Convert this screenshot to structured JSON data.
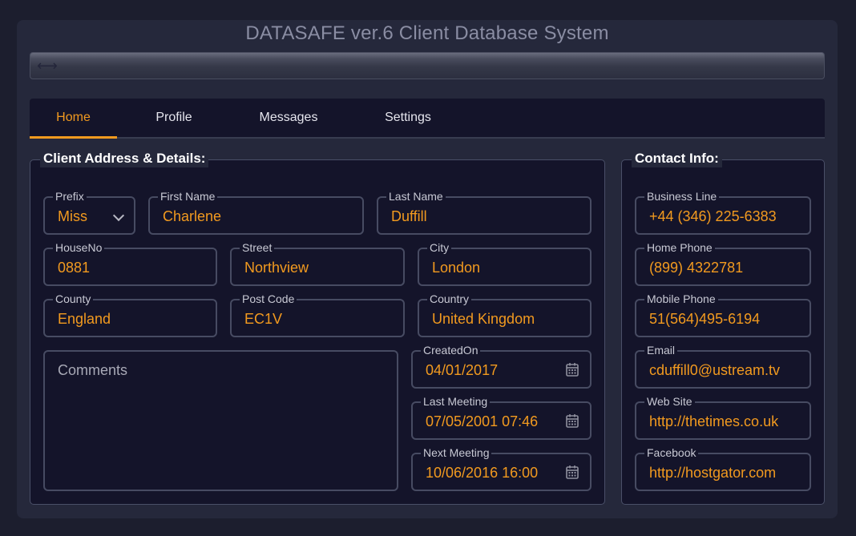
{
  "app": {
    "title": "DATASAFE ver.6 Client Database System"
  },
  "toolbar": {
    "grip_icon": "⟷"
  },
  "tabs": [
    {
      "label": "Home",
      "active": true
    },
    {
      "label": "Profile",
      "active": false
    },
    {
      "label": "Messages",
      "active": false
    },
    {
      "label": "Settings",
      "active": false
    }
  ],
  "client_section": {
    "title": "Client Address & Details:",
    "prefix": {
      "label": "Prefix",
      "value": "Miss"
    },
    "first_name": {
      "label": "First Name",
      "value": "Charlene"
    },
    "last_name": {
      "label": "Last Name",
      "value": "Duffill"
    },
    "house_no": {
      "label": "HouseNo",
      "value": "0881"
    },
    "street": {
      "label": "Street",
      "value": "Northview"
    },
    "city": {
      "label": "City",
      "value": "London"
    },
    "county": {
      "label": "County",
      "value": "England"
    },
    "post_code": {
      "label": "Post Code",
      "value": "EC1V"
    },
    "country": {
      "label": "Country",
      "value": "United Kingdom"
    },
    "comments": {
      "placeholder": "Comments"
    },
    "created_on": {
      "label": "CreatedOn",
      "value": "04/01/2017"
    },
    "last_meeting": {
      "label": "Last Meeting",
      "value": "07/05/2001 07:46"
    },
    "next_meeting": {
      "label": "Next Meeting",
      "value": "10/06/2016 16:00"
    }
  },
  "contact_section": {
    "title": "Contact Info:",
    "business_line": {
      "label": "Business Line",
      "value": "+44 (346) 225-6383"
    },
    "home_phone": {
      "label": "Home Phone",
      "value": "(899) 4322781"
    },
    "mobile_phone": {
      "label": "Mobile Phone",
      "value": "51(564)495-6194"
    },
    "email": {
      "label": "Email",
      "value": "cduffill0@ustream.tv"
    },
    "web_site": {
      "label": "Web Site",
      "value": "http://thetimes.co.uk"
    },
    "facebook": {
      "label": "Facebook",
      "value": "http://hostgator.com"
    }
  },
  "colors": {
    "accent": "#f29a1f",
    "background": "#14142a",
    "border": "#474b62"
  }
}
